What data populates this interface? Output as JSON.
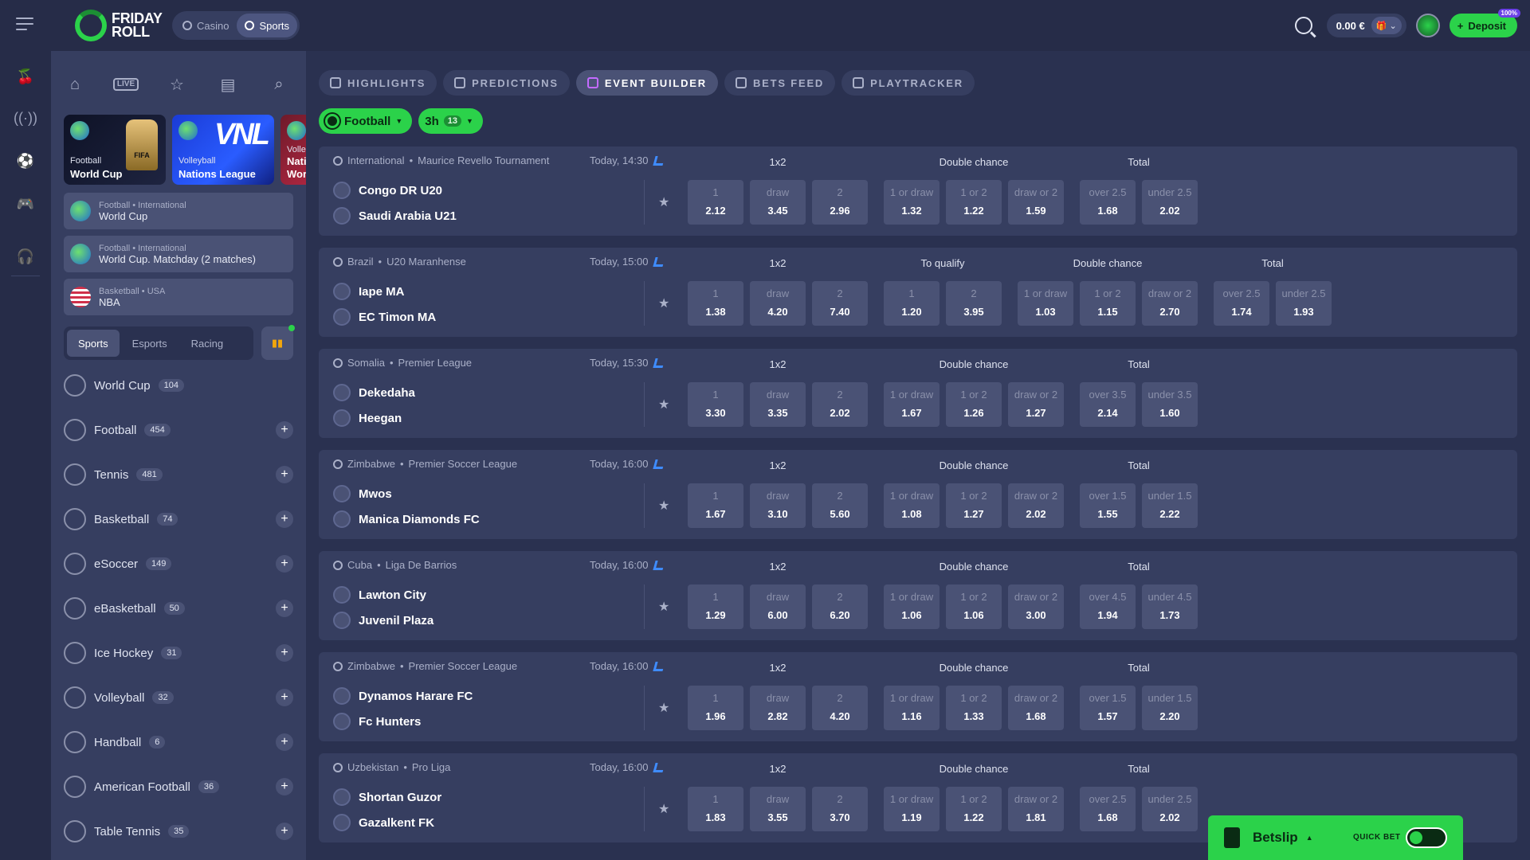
{
  "brand": {
    "logo_line1": "FRIDAY",
    "logo_line2": "ROLL"
  },
  "modes": [
    {
      "label": "Casino"
    },
    {
      "label": "Sports"
    }
  ],
  "topbar": {
    "balance": "0.00 €",
    "deposit_label": "Deposit",
    "deposit_badge": "100%",
    "accent": "#2bd24a"
  },
  "sidebar": {
    "cards": [
      {
        "sport": "Football",
        "name": "World Cup"
      },
      {
        "sport": "Volleyball",
        "name": "Nations League"
      },
      {
        "sport": "Volle",
        "name": "Nati"
      }
    ],
    "card_overlay": {
      "vnl": "VNL",
      "fifa": "FIFA",
      "wor": "Wor"
    },
    "favorites": [
      {
        "path": "Football • International",
        "name": "World Cup"
      },
      {
        "path": "Football • International",
        "name": "World Cup. Matchday (2 matches)"
      },
      {
        "path": "Basketball • USA",
        "name": "NBA"
      }
    ],
    "segments": [
      "Sports",
      "Esports",
      "Racing"
    ],
    "sports": [
      {
        "name": "World Cup",
        "count": "104"
      },
      {
        "name": "Football",
        "count": "454"
      },
      {
        "name": "Tennis",
        "count": "481"
      },
      {
        "name": "Basketball",
        "count": "74"
      },
      {
        "name": "eSoccer",
        "count": "149"
      },
      {
        "name": "eBasketball",
        "count": "50"
      },
      {
        "name": "Ice Hockey",
        "count": "31"
      },
      {
        "name": "Volleyball",
        "count": "32"
      },
      {
        "name": "Handball",
        "count": "6"
      },
      {
        "name": "American Football",
        "count": "36"
      },
      {
        "name": "Table Tennis",
        "count": "35"
      }
    ],
    "nav_live": "LIVE"
  },
  "tabs": [
    "HIGHLIGHTS",
    "PREDICTIONS",
    "EVENT BUILDER",
    "BETS FEED",
    "PLAYTRACKER"
  ],
  "filters": {
    "sport": "Football",
    "time": "3h",
    "time_count": "13"
  },
  "events": [
    {
      "country": "International",
      "league": "Maurice Revello Tournament",
      "time": "Today, 14:30",
      "home": "Congo DR U20",
      "away": "Saudi Arabia U21",
      "groups": [
        {
          "title": "1x2",
          "odds": [
            [
              "1",
              "2.12"
            ],
            [
              "draw",
              "3.45"
            ],
            [
              "2",
              "2.96"
            ]
          ]
        },
        {
          "title": "Double chance",
          "odds": [
            [
              "1 or draw",
              "1.32"
            ],
            [
              "1 or 2",
              "1.22"
            ],
            [
              "draw or 2",
              "1.59"
            ]
          ]
        },
        {
          "title": "Total",
          "odds": [
            [
              "over 2.5",
              "1.68"
            ],
            [
              "under 2.5",
              "2.02"
            ]
          ]
        }
      ]
    },
    {
      "country": "Brazil",
      "league": "U20 Maranhense",
      "time": "Today, 15:00",
      "home": "Iape MA",
      "away": "EC Timon MA",
      "groups": [
        {
          "title": "1x2",
          "odds": [
            [
              "1",
              "1.38"
            ],
            [
              "draw",
              "4.20"
            ],
            [
              "2",
              "7.40"
            ]
          ]
        },
        {
          "title": "To qualify",
          "odds": [
            [
              "1",
              "1.20"
            ],
            [
              "2",
              "3.95"
            ]
          ]
        },
        {
          "title": "Double chance",
          "odds": [
            [
              "1 or draw",
              "1.03"
            ],
            [
              "1 or 2",
              "1.15"
            ],
            [
              "draw or 2",
              "2.70"
            ]
          ]
        },
        {
          "title": "Total",
          "odds": [
            [
              "over 2.5",
              "1.74"
            ],
            [
              "under 2.5",
              "1.93"
            ]
          ]
        }
      ]
    },
    {
      "country": "Somalia",
      "league": "Premier League",
      "time": "Today, 15:30",
      "home": "Dekedaha",
      "away": "Heegan",
      "groups": [
        {
          "title": "1x2",
          "odds": [
            [
              "1",
              "3.30"
            ],
            [
              "draw",
              "3.35"
            ],
            [
              "2",
              "2.02"
            ]
          ]
        },
        {
          "title": "Double chance",
          "odds": [
            [
              "1 or draw",
              "1.67"
            ],
            [
              "1 or 2",
              "1.26"
            ],
            [
              "draw or 2",
              "1.27"
            ]
          ]
        },
        {
          "title": "Total",
          "odds": [
            [
              "over 3.5",
              "2.14"
            ],
            [
              "under 3.5",
              "1.60"
            ]
          ]
        }
      ]
    },
    {
      "country": "Zimbabwe",
      "league": "Premier Soccer League",
      "time": "Today, 16:00",
      "home": "Mwos",
      "away": "Manica Diamonds FC",
      "groups": [
        {
          "title": "1x2",
          "odds": [
            [
              "1",
              "1.67"
            ],
            [
              "draw",
              "3.10"
            ],
            [
              "2",
              "5.60"
            ]
          ]
        },
        {
          "title": "Double chance",
          "odds": [
            [
              "1 or draw",
              "1.08"
            ],
            [
              "1 or 2",
              "1.27"
            ],
            [
              "draw or 2",
              "2.02"
            ]
          ]
        },
        {
          "title": "Total",
          "odds": [
            [
              "over 1.5",
              "1.55"
            ],
            [
              "under 1.5",
              "2.22"
            ]
          ]
        }
      ]
    },
    {
      "country": "Cuba",
      "league": "Liga De Barrios",
      "time": "Today, 16:00",
      "home": "Lawton City",
      "away": "Juvenil Plaza",
      "groups": [
        {
          "title": "1x2",
          "odds": [
            [
              "1",
              "1.29"
            ],
            [
              "draw",
              "6.00"
            ],
            [
              "2",
              "6.20"
            ]
          ]
        },
        {
          "title": "Double chance",
          "odds": [
            [
              "1 or draw",
              "1.06"
            ],
            [
              "1 or 2",
              "1.06"
            ],
            [
              "draw or 2",
              "3.00"
            ]
          ]
        },
        {
          "title": "Total",
          "odds": [
            [
              "over 4.5",
              "1.94"
            ],
            [
              "under 4.5",
              "1.73"
            ]
          ]
        }
      ]
    },
    {
      "country": "Zimbabwe",
      "league": "Premier Soccer League",
      "time": "Today, 16:00",
      "home": "Dynamos Harare FC",
      "away": "Fc Hunters",
      "groups": [
        {
          "title": "1x2",
          "odds": [
            [
              "1",
              "1.96"
            ],
            [
              "draw",
              "2.82"
            ],
            [
              "2",
              "4.20"
            ]
          ]
        },
        {
          "title": "Double chance",
          "odds": [
            [
              "1 or draw",
              "1.16"
            ],
            [
              "1 or 2",
              "1.33"
            ],
            [
              "draw or 2",
              "1.68"
            ]
          ]
        },
        {
          "title": "Total",
          "odds": [
            [
              "over 1.5",
              "1.57"
            ],
            [
              "under 1.5",
              "2.20"
            ]
          ]
        }
      ]
    },
    {
      "country": "Uzbekistan",
      "league": "Pro Liga",
      "time": "Today, 16:00",
      "home": "Shortan Guzor",
      "away": "Gazalkent FK",
      "groups": [
        {
          "title": "1x2",
          "odds": [
            [
              "1",
              "1.83"
            ],
            [
              "draw",
              "3.55"
            ],
            [
              "2",
              "3.70"
            ]
          ]
        },
        {
          "title": "Double chance",
          "odds": [
            [
              "1 or draw",
              "1.19"
            ],
            [
              "1 or 2",
              "1.22"
            ],
            [
              "draw or 2",
              "1.81"
            ]
          ]
        },
        {
          "title": "Total",
          "odds": [
            [
              "over 2.5",
              "1.68"
            ],
            [
              "under 2.5",
              "2.02"
            ]
          ]
        }
      ]
    }
  ],
  "betslip": {
    "label": "Betslip",
    "quick_bet": "QUICK BET"
  }
}
